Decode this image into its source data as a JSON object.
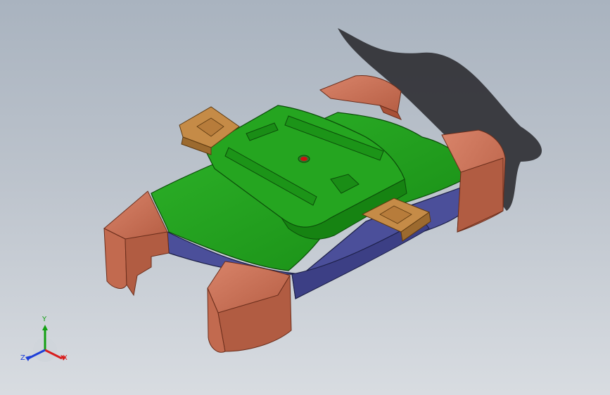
{
  "viewport": {
    "background_top": "#a9b3bf",
    "background_bottom": "#d8dce1"
  },
  "model": {
    "body_color": "#1f9a1a",
    "base_color": "#4b4f9a",
    "clip_color": "#c46a4e",
    "latch_color": "#b47a36",
    "indicator_color": "#cc1111",
    "shadow_color": "#2f2f33"
  },
  "triad": {
    "x_label": "X",
    "y_label": "Y",
    "z_label": "Z",
    "x_color": "#d81e1e",
    "y_color": "#12a012",
    "z_color": "#1e3fd8"
  }
}
